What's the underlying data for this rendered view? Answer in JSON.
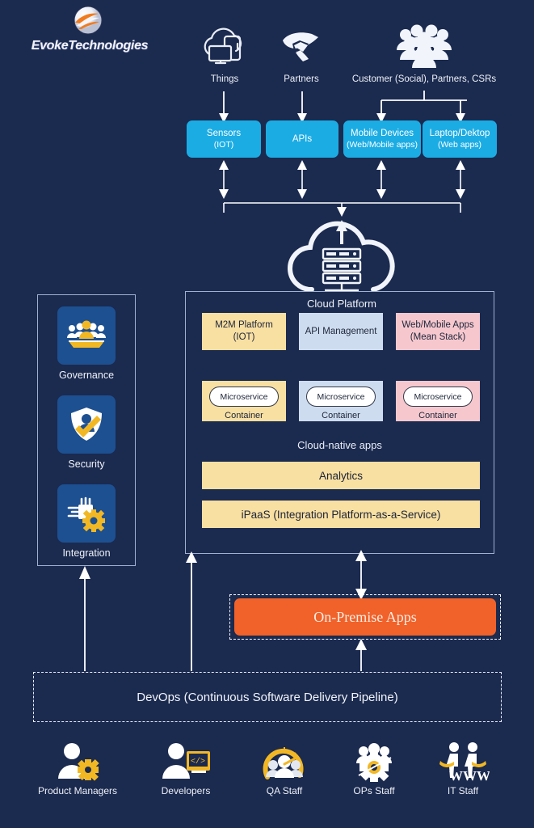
{
  "brand": {
    "name": "EvokeTechnologies",
    "logo_icon": "evoke-swoosh-logo"
  },
  "top_actors": [
    {
      "id": "things",
      "label": "Things",
      "icon": "cloud-devices-icon"
    },
    {
      "id": "partners",
      "label": "Partners",
      "icon": "handshake-icon"
    },
    {
      "id": "customers",
      "label": "Customer (Social), Partners, CSRs",
      "icon": "people-group-icon"
    }
  ],
  "channels": [
    {
      "id": "sensors",
      "line1": "Sensors",
      "line2": "(IOT)"
    },
    {
      "id": "apis",
      "line1": "APIs",
      "line2": ""
    },
    {
      "id": "mobile",
      "line1": "Mobile Devices",
      "line2": "(Web/Mobile apps)"
    },
    {
      "id": "laptop",
      "line1": "Laptop/Dektop",
      "line2": "(Web apps)"
    }
  ],
  "cloud": {
    "icon": "cloud-server-icon",
    "caption": "Cloud Platform",
    "platforms": [
      {
        "id": "m2m",
        "line1": "M2M Platform",
        "line2": "(IOT)",
        "color": "#f8dfa2"
      },
      {
        "id": "apim",
        "line1": "API Management",
        "line2": "",
        "color": "#cedcef"
      },
      {
        "id": "webmobile",
        "line1": "Web/Mobile Apps",
        "line2": "(Mean Stack)",
        "color": "#f6c8ce"
      }
    ],
    "microservices": [
      {
        "id": "ms-yellow",
        "pill": "Microservice",
        "label": "Container",
        "color": "#f8dfa2"
      },
      {
        "id": "ms-blue",
        "pill": "Microservice",
        "label": "Container",
        "color": "#cedcef"
      },
      {
        "id": "ms-pink",
        "pill": "Microservice",
        "label": "Container",
        "color": "#f6c8ce"
      }
    ],
    "cloud_native_label": "Cloud-native apps",
    "bars": [
      {
        "id": "analytics",
        "label": "Analytics"
      },
      {
        "id": "ipaas",
        "label": "iPaaS (Integration Platform-as-a-Service)"
      }
    ]
  },
  "pillars": [
    {
      "id": "governance",
      "label": "Governance",
      "icon": "governance-people-table-icon"
    },
    {
      "id": "security",
      "label": "Security",
      "icon": "shield-person-check-icon"
    },
    {
      "id": "integration",
      "label": "Integration",
      "icon": "chip-gear-icon"
    }
  ],
  "onpremise": {
    "label": "On-Premise Apps",
    "color": "#f0622a"
  },
  "devops": {
    "label": "DevOps (Continuous Software Delivery Pipeline)"
  },
  "personas": [
    {
      "id": "product-managers",
      "label": "Product Managers",
      "icon": "person-gear-icon"
    },
    {
      "id": "developers",
      "label": "Developers",
      "icon": "person-code-screen-icon"
    },
    {
      "id": "qa-staff",
      "label": "QA Staff",
      "icon": "people-gauge-icon"
    },
    {
      "id": "ops-staff",
      "label": "OPs Staff",
      "icon": "people-gear-icon"
    },
    {
      "id": "it-staff",
      "label": "IT Staff",
      "icon": "people-www-icon"
    }
  ],
  "colors": {
    "background": "#1b2a4f",
    "cyan": "#1cace4",
    "yellow": "#f8dfa2",
    "blue": "#cedcef",
    "pink": "#f6c8ce",
    "orange": "#f0622a",
    "tile_blue": "#1d5091",
    "accent_gold": "#f2b824"
  }
}
